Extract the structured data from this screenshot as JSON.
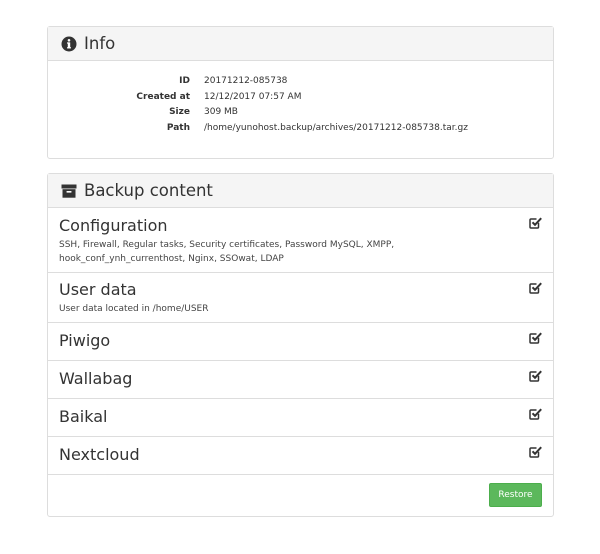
{
  "info": {
    "title": "Info",
    "icon": "info-circle-icon",
    "rows": [
      {
        "label": "ID",
        "value": "20171212-085738"
      },
      {
        "label": "Created at",
        "value": "12/12/2017 07:57 AM"
      },
      {
        "label": "Size",
        "value": "309 MB"
      },
      {
        "label": "Path",
        "value": "/home/yunohost.backup/archives/20171212-085738.tar.gz"
      }
    ]
  },
  "backup": {
    "title": "Backup content",
    "icon": "archive-icon",
    "items": [
      {
        "title": "Configuration",
        "description": "SSH, Firewall, Regular tasks, Security certificates, Password MySQL, XMPP, hook_conf_ynh_currenthost, Nginx, SSOwat, LDAP",
        "checked": true
      },
      {
        "title": "User data",
        "description": "User data located in /home/USER",
        "checked": true
      },
      {
        "title": "Piwigo",
        "description": "",
        "checked": true
      },
      {
        "title": "Wallabag",
        "description": "",
        "checked": true
      },
      {
        "title": "Baikal",
        "description": "",
        "checked": true
      },
      {
        "title": "Nextcloud",
        "description": "",
        "checked": true
      }
    ],
    "restore_label": "Restore"
  },
  "colors": {
    "restore_button": "#5cb85c",
    "panel_heading_bg": "#f5f5f5",
    "border": "#dddddd"
  }
}
